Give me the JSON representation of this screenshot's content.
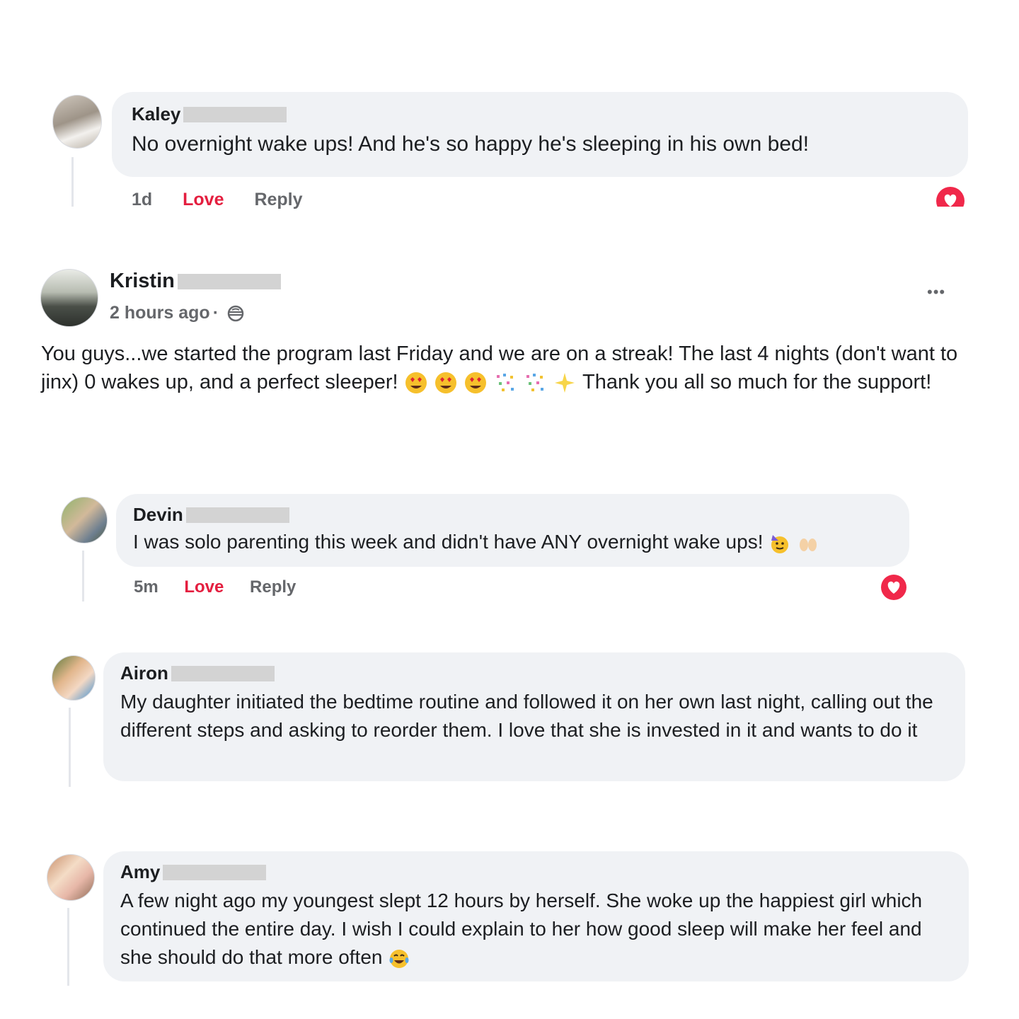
{
  "comments": [
    {
      "author": "Kaley",
      "text": "No overnight wake ups! And he's so happy he's sleeping in his own bed!",
      "time": "1d",
      "love_label": "Love",
      "reply_label": "Reply"
    },
    {
      "author": "Devin",
      "text": "I was solo parenting this week and didn't have ANY overnight wake ups!",
      "time": "5m",
      "love_label": "Love",
      "reply_label": "Reply"
    },
    {
      "author": "Airon",
      "text": "My daughter initiated the bedtime routine and followed it on her own last night, calling out the different steps and asking to reorder them. I love that she is invested in it and wants to do it"
    },
    {
      "author": "Amy",
      "text": "A few night ago my youngest slept 12 hours by herself. She woke up the happiest girl which continued the entire day. I wish I could explain to her how good sleep will make her feel and she should do that more often"
    }
  ],
  "post": {
    "author": "Kristin",
    "time": "2 hours ago",
    "separator": "·",
    "more_label": "•••",
    "text_part1": "You guys...we started the program last Friday and we are on a streak! The last 4 nights (don't want to jinx) 0 wakes up, and a perfect sleeper!",
    "text_part2": "Thank you all so much for the support!"
  },
  "colors": {
    "bubble": "#f0f2f5",
    "love": "#e41e3f",
    "meta": "#65676b"
  },
  "icons": {
    "globe": "globe-icon",
    "heart": "heart-reaction-icon",
    "more": "more-options-icon"
  }
}
